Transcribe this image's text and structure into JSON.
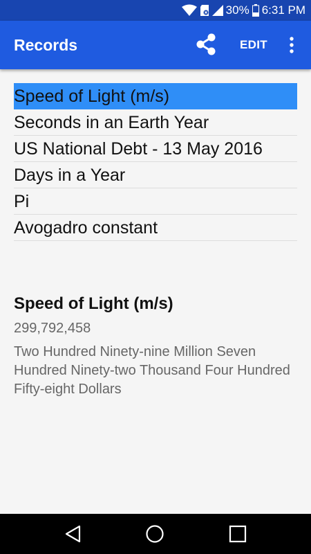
{
  "status_bar": {
    "battery": "30%",
    "time": "6:31 PM"
  },
  "app_bar": {
    "title": "Records",
    "edit_label": "EDIT",
    "icons": [
      "share-icon",
      "more-vert-icon"
    ]
  },
  "records": [
    {
      "label": "Speed of Light (m/s)",
      "selected": true
    },
    {
      "label": "Seconds in an Earth Year",
      "selected": false
    },
    {
      "label": "US National Debt - 13 May 2016",
      "selected": false
    },
    {
      "label": "Days in a Year",
      "selected": false
    },
    {
      "label": "Pi",
      "selected": false
    },
    {
      "label": "Avogadro constant",
      "selected": false
    }
  ],
  "detail": {
    "title": "Speed of Light (m/s)",
    "value": "299,792,458",
    "words": "Two Hundred Ninety-nine Million Seven Hundred Ninety-two Thousand Four Hundred Fifty-eight Dollars"
  },
  "nav_bar": {
    "icons": [
      "back-icon",
      "home-icon",
      "recents-icon"
    ]
  },
  "colors": {
    "app_bar": "#1f5be0",
    "status_bar": "#1845b0",
    "selection": "#2f8ef7"
  }
}
